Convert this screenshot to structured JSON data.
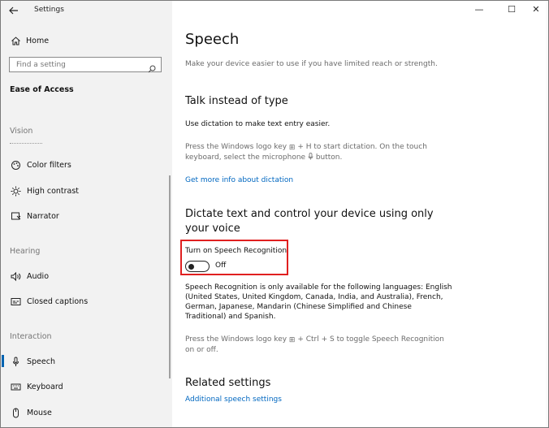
{
  "window": {
    "title": "Settings",
    "controls": {
      "minimize": "—",
      "maximize": "☐",
      "close": "✕"
    }
  },
  "sidebar": {
    "home_label": "Home",
    "search_placeholder": "Find a setting",
    "section_title": "Ease of Access",
    "groups": {
      "vision": "Vision",
      "hearing": "Hearing",
      "interaction": "Interaction"
    },
    "items": [
      {
        "label": "Color filters",
        "icon": "color-filters-icon"
      },
      {
        "label": "High contrast",
        "icon": "high-contrast-icon"
      },
      {
        "label": "Narrator",
        "icon": "narrator-icon"
      },
      {
        "label": "Audio",
        "icon": "audio-icon"
      },
      {
        "label": "Closed captions",
        "icon": "closed-captions-icon"
      },
      {
        "label": "Speech",
        "icon": "speech-icon",
        "selected": true
      },
      {
        "label": "Keyboard",
        "icon": "keyboard-icon"
      },
      {
        "label": "Mouse",
        "icon": "mouse-icon"
      }
    ]
  },
  "main": {
    "title": "Speech",
    "subtitle": "Make your device easier to use if you have limited reach or strength.",
    "talk_section": {
      "heading": "Talk instead of type",
      "description": "Use dictation to make text entry easier.",
      "hint_line1_a": "Press the Windows logo key ",
      "hint_line1_b": " + H to start dictation.  On the touch",
      "hint_line2_a": "keyboard, select the microphone ",
      "hint_line2_b": " button.",
      "link": "Get more info about dictation"
    },
    "dictate_section": {
      "heading_line1": "Dictate text and control your device using only",
      "heading_line2": "your voice",
      "toggle_label": "Turn on Speech Recognition",
      "toggle_state": "Off",
      "toggle_on": false,
      "languages_line1": "Speech Recognition is only available for the following languages: English",
      "languages_line2": "(United States, United Kingdom, Canada, India, and Australia), French,",
      "languages_line3": "German, Japanese, Mandarin (Chinese Simplified and Chinese",
      "languages_line4": "Traditional) and Spanish.",
      "hint_line1_a": "Press the Windows logo key ",
      "hint_line1_b": " + Ctrl + S to toggle Speech Recognition",
      "hint_line2": "on or off."
    },
    "related": {
      "heading": "Related settings",
      "link": "Additional speech settings"
    }
  },
  "colors": {
    "accent": "#0067c0",
    "highlight": "#e02020",
    "sidebar_bg": "#f2f2f2"
  }
}
